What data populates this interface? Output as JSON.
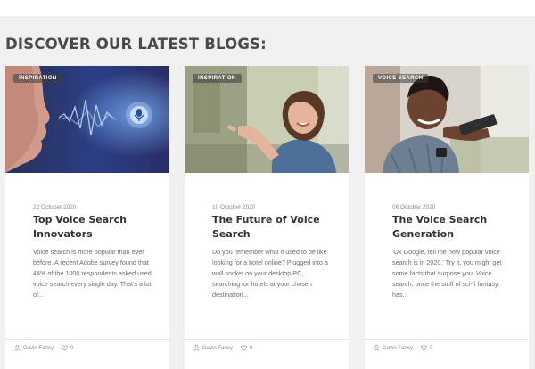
{
  "section": {
    "title": "DISCOVER OUR LATEST BLOGS:"
  },
  "cards": [
    {
      "category": "INSPIRATION",
      "date": "22 October 2020",
      "title": "Top Voice Search Innovators",
      "excerpt": "Voice search is more popular than ever before. A recent Adobe survey found that 44% of the 1000 respondents asked used voice search every single day. That's a lot of...",
      "author": "Gavin Farley",
      "likes": "0"
    },
    {
      "category": "INSPIRATION",
      "date": "10 October 2020",
      "title": "The Future of Voice Search",
      "excerpt": "Do you remember what it used to be like looking for a hotel online? Plugged into a wall socket on your desktop PC, searching for hotels at your chosen destination...",
      "author": "Gavin Farley",
      "likes": "0"
    },
    {
      "category": "VOICE SEARCH",
      "date": "06 October 2020",
      "title": "The Voice Search Generation",
      "excerpt": "'Ok Google, tell me how popular voice search is in 2020.' Try it, you might get some facts that surprise you. Voice search, once the stuff of sci-fi fantasy, has...",
      "author": "Gavin Farley",
      "likes": "0"
    }
  ],
  "colors": {
    "page_bg": "#f0f0f0",
    "card_bg": "#ffffff",
    "title_text": "#333333",
    "body_text": "#6d6d6d",
    "meta_text": "#8a8a8a",
    "badge_bg": "#3c3c3c"
  }
}
